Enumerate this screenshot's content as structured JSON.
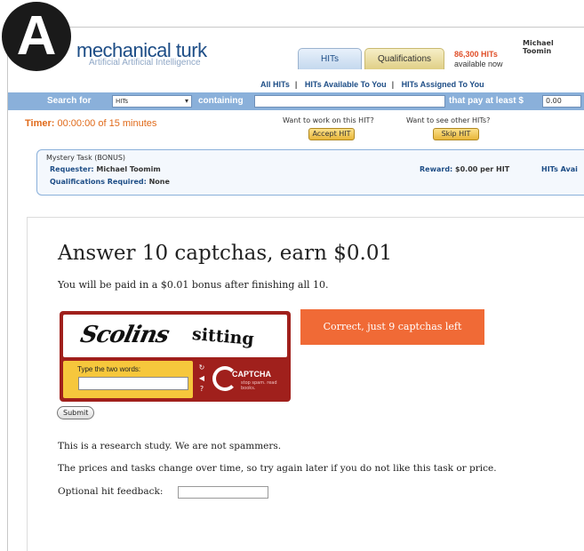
{
  "badge": "A",
  "header": {
    "logo_title": "mechanical turk",
    "logo_tagline": "Artificial Artificial Intelligence",
    "tabs": [
      "HITs",
      "Qualifications"
    ],
    "available_count": "86,300 HITs",
    "available_text": "available now",
    "user_name": "Michael Toomin"
  },
  "nav": [
    "All HITs",
    "HITs Available To You",
    "HITs Assigned To You"
  ],
  "search": {
    "label": "Search for",
    "select_value": "HITs",
    "containing_label": "containing",
    "pay_label": "that pay at least $",
    "pay_value": "0.00"
  },
  "timer": {
    "label": "Timer:",
    "value": "00:00:00 of 15 minutes"
  },
  "actions": {
    "accept_prompt": "Want to work on this HIT?",
    "accept_button": "Accept HIT",
    "skip_prompt": "Want to see other HITs?",
    "skip_button": "Skip HIT"
  },
  "hit": {
    "title": "Mystery Task (BONUS)",
    "requester_label": "Requester:",
    "requester": "Michael Toomim",
    "reward_label": "Reward:",
    "reward": "$0.00 per HIT",
    "hits_available_label": "HITs Avai",
    "qual_label": "Qualifications Required:",
    "qual": "None"
  },
  "task": {
    "title": "Answer 10 captchas, earn $0.01",
    "subtitle": "You will be paid in a $0.01 bonus after finishing all 10.",
    "captcha_word1": "Scolins",
    "captcha_word2": "sitting",
    "captcha_prompt": "Type the two words:",
    "captcha_brand": "CAPTCHA",
    "captcha_tag": "stop spam. read books.",
    "correct_message": "Correct, just 9 captchas left",
    "submit_label": "Submit",
    "note1": "This is a research study. We are not spammers.",
    "note2": "The prices and tasks change over time, so try again later if you do not like this task or price.",
    "feedback_label": "Optional hit feedback:"
  }
}
